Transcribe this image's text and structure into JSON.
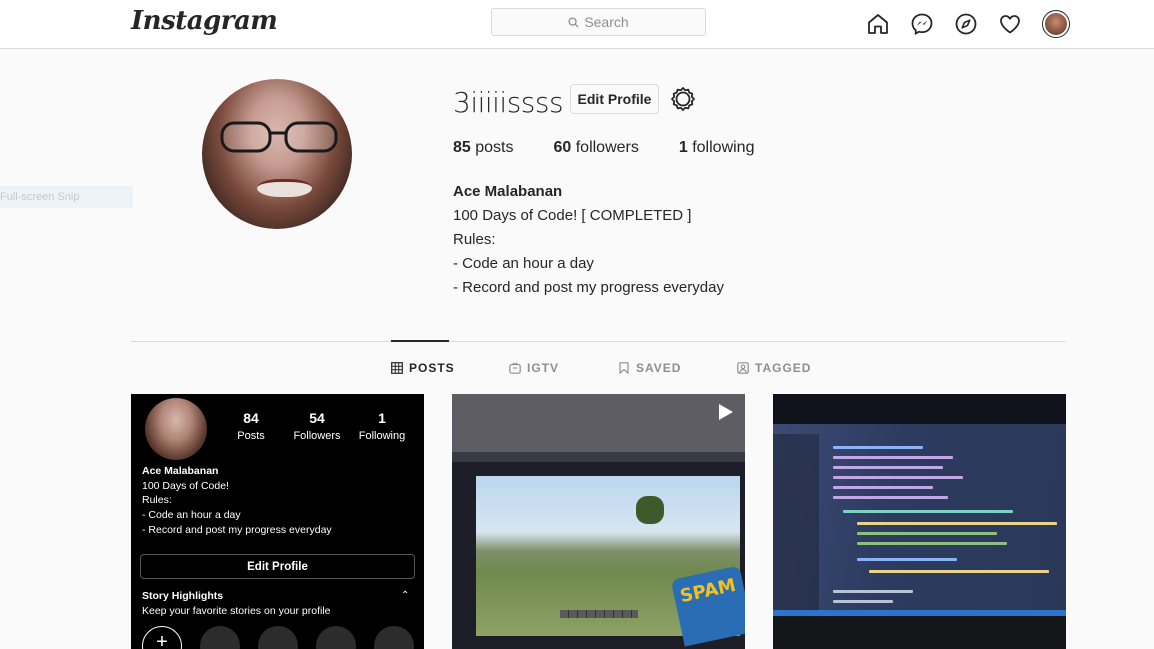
{
  "nav": {
    "logo": "Instagram",
    "search_placeholder": "Search"
  },
  "snip_label": "Full-screen Snip",
  "profile": {
    "username": "3iiiiissss",
    "edit_label": "Edit Profile",
    "stats": [
      {
        "count": "85",
        "label": " posts"
      },
      {
        "count": "60",
        "label": " followers"
      },
      {
        "count": "1",
        "label": " following"
      }
    ],
    "full_name": "Ace Malabanan",
    "bio_lines": [
      "100 Days of Code! [ COMPLETED ]",
      "Rules:",
      "- Code an hour a day",
      "- Record and post my progress everyday"
    ]
  },
  "tabs": [
    {
      "label": "POSTS",
      "icon": "grid-icon",
      "active": true
    },
    {
      "label": "IGTV",
      "icon": "igtv-icon",
      "active": false
    },
    {
      "label": "SAVED",
      "icon": "bookmark-icon",
      "active": false
    },
    {
      "label": "TAGGED",
      "icon": "tagged-icon",
      "active": false
    }
  ],
  "post1": {
    "stats": [
      {
        "count": "84",
        "label": "Posts"
      },
      {
        "count": "54",
        "label": "Followers"
      },
      {
        "count": "1",
        "label": "Following"
      }
    ],
    "name": "Ace Malabanan",
    "bio_lines": [
      "100 Days of Code!",
      "Rules:",
      "- Code an hour a day",
      "- Record and post my progress everyday"
    ],
    "edit_label": "Edit Profile",
    "highlights_title": "Story Highlights",
    "highlights_sub": "Keep your favorite stories on your profile",
    "plus": "+"
  },
  "post2": {
    "can_text": "SPAM"
  },
  "colors": {
    "border": "#dbdbdb",
    "text": "#262626",
    "muted": "#8e8e8e",
    "background": "#fafafa"
  }
}
